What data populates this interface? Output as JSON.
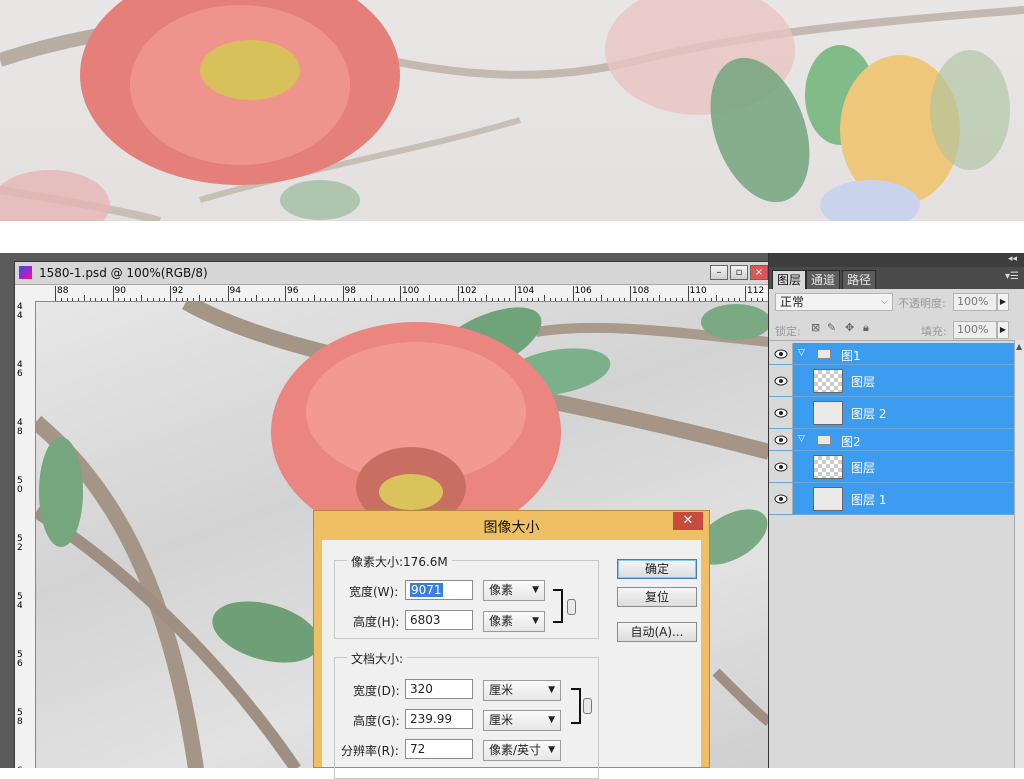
{
  "document": {
    "title": "1580-1.psd @ 100%(RGB/8)",
    "ruler_h_ticks": [
      "88",
      "90",
      "92",
      "94",
      "96",
      "98",
      "100",
      "102",
      "104",
      "106",
      "108",
      "110",
      "112"
    ],
    "ruler_v_ticks": [
      "44",
      "46",
      "48",
      "50",
      "52",
      "54",
      "56",
      "58",
      "6"
    ]
  },
  "dialog": {
    "title": "图像大小",
    "close": "✕",
    "pixel_group": {
      "title": "像素大小:176.6M",
      "width_label": "宽度(W):",
      "width_value": "9071",
      "width_unit": "像素",
      "height_label": "高度(H):",
      "height_value": "6803",
      "height_unit": "像素"
    },
    "doc_group": {
      "title": "文档大小:",
      "width_label": "宽度(D):",
      "width_value": "320",
      "width_unit": "厘米",
      "height_label": "高度(G):",
      "height_value": "239.99",
      "height_unit": "厘米",
      "res_label": "分辨率(R):",
      "res_value": "72",
      "res_unit": "像素/英寸"
    },
    "ok_label": "确定",
    "reset_label": "复位",
    "auto_label": "自动(A)..."
  },
  "layers_panel": {
    "tabs": [
      "图层",
      "通道",
      "路径"
    ],
    "blend_mode": "正常",
    "opacity_label": "不透明度:",
    "opacity_value": "100%",
    "lock_label": "锁定:",
    "fill_label": "填充:",
    "fill_value": "100%",
    "layers": [
      {
        "name": "图1",
        "type": "group"
      },
      {
        "name": "图层",
        "type": "layer"
      },
      {
        "name": "图层 2",
        "type": "layer"
      },
      {
        "name": "图2",
        "type": "group"
      },
      {
        "name": "图层",
        "type": "layer"
      },
      {
        "name": "图层 1",
        "type": "layer"
      }
    ]
  },
  "colors": {
    "accent": "#3c9cf0",
    "dialog_frame": "#efc063",
    "close_button": "#c74a3d"
  }
}
